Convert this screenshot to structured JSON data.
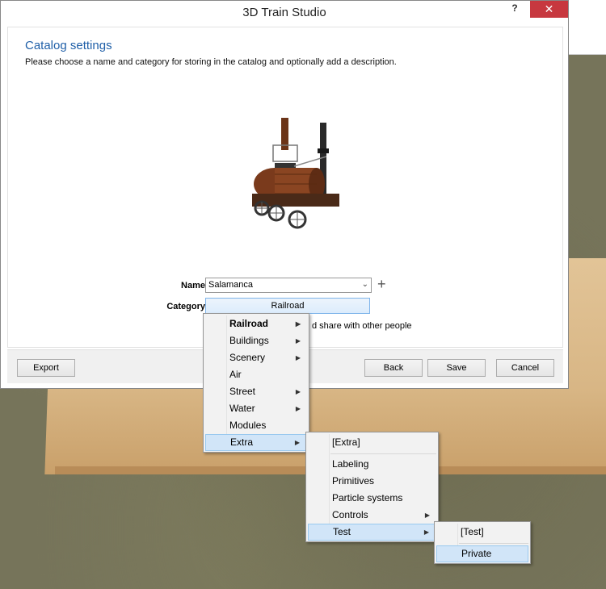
{
  "window": {
    "title": "3D Train Studio",
    "help_label": "?",
    "close_label": "✕"
  },
  "catalog": {
    "heading": "Catalog settings",
    "description": "Please choose a name and category for storing in the catalog and optionally add a description.",
    "name_label": "Name",
    "name_value": "Salamanca",
    "category_label": "Category",
    "category_value": "Railroad",
    "share_text": "d share with other people",
    "plus_label": "+"
  },
  "buttons": {
    "export": "Export",
    "back": "Back",
    "save": "Save",
    "cancel": "Cancel"
  },
  "menu1": {
    "items": [
      "Railroad",
      "Buildings",
      "Scenery",
      "Air",
      "Street",
      "Water",
      "Modules",
      "Extra"
    ],
    "selected": "Extra"
  },
  "menu2": {
    "items": [
      "[Extra]",
      "Labeling",
      "Primitives",
      "Particle systems",
      "Controls",
      "Test"
    ],
    "selected": "Test"
  },
  "menu3": {
    "items": [
      "[Test]",
      "Private"
    ],
    "selected": "Private"
  },
  "colors": {
    "heading": "#1f5fa8",
    "close": "#c7383f",
    "highlight": "#d1e5f8"
  }
}
